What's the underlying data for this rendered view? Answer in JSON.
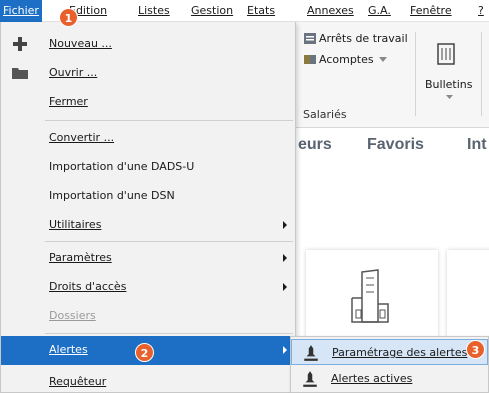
{
  "menubar": {
    "items": [
      {
        "label": "Fichier"
      },
      {
        "label": "Edition"
      },
      {
        "label": "Listes"
      },
      {
        "label": "Gestion"
      },
      {
        "label": "Etats"
      },
      {
        "label": "Annexes"
      },
      {
        "label": "G.A."
      },
      {
        "label": "Fenêtre"
      },
      {
        "label": "?"
      }
    ]
  },
  "ribbon": {
    "arrets": "Arrêts de travail",
    "acomptes": "Acomptes",
    "salaries": "Salariés",
    "bulletins": "Bulletins"
  },
  "content": {
    "tab1": "eurs",
    "tab2": "Favoris",
    "tab3": "Int"
  },
  "menu": {
    "items": [
      {
        "label": "Nouveau ...",
        "icon": "plus-icon"
      },
      {
        "label": "Ouvrir ...",
        "icon": "folder-icon"
      },
      {
        "label": "Fermer"
      },
      {
        "label": "Convertir ..."
      },
      {
        "label": "Importation d'une DADS-U"
      },
      {
        "label": "Importation d'une DSN"
      },
      {
        "label": "Utilitaires"
      },
      {
        "label": "Paramètres"
      },
      {
        "label": "Droits d'accès"
      },
      {
        "label": "Dossiers"
      },
      {
        "label": "Alertes"
      },
      {
        "label": "Requêteur"
      }
    ]
  },
  "submenu": {
    "items": [
      {
        "label": "Paramétrage des alertes",
        "icon": "alert-settings-icon"
      },
      {
        "label": "Alertes actives",
        "icon": "alert-active-icon"
      }
    ]
  },
  "badges": {
    "b1": "1",
    "b2": "2",
    "b3": "3"
  },
  "colors": {
    "highlight": "#1c6fc4",
    "badge": "#e8602c",
    "menu_bg": "#f2f2f2"
  }
}
